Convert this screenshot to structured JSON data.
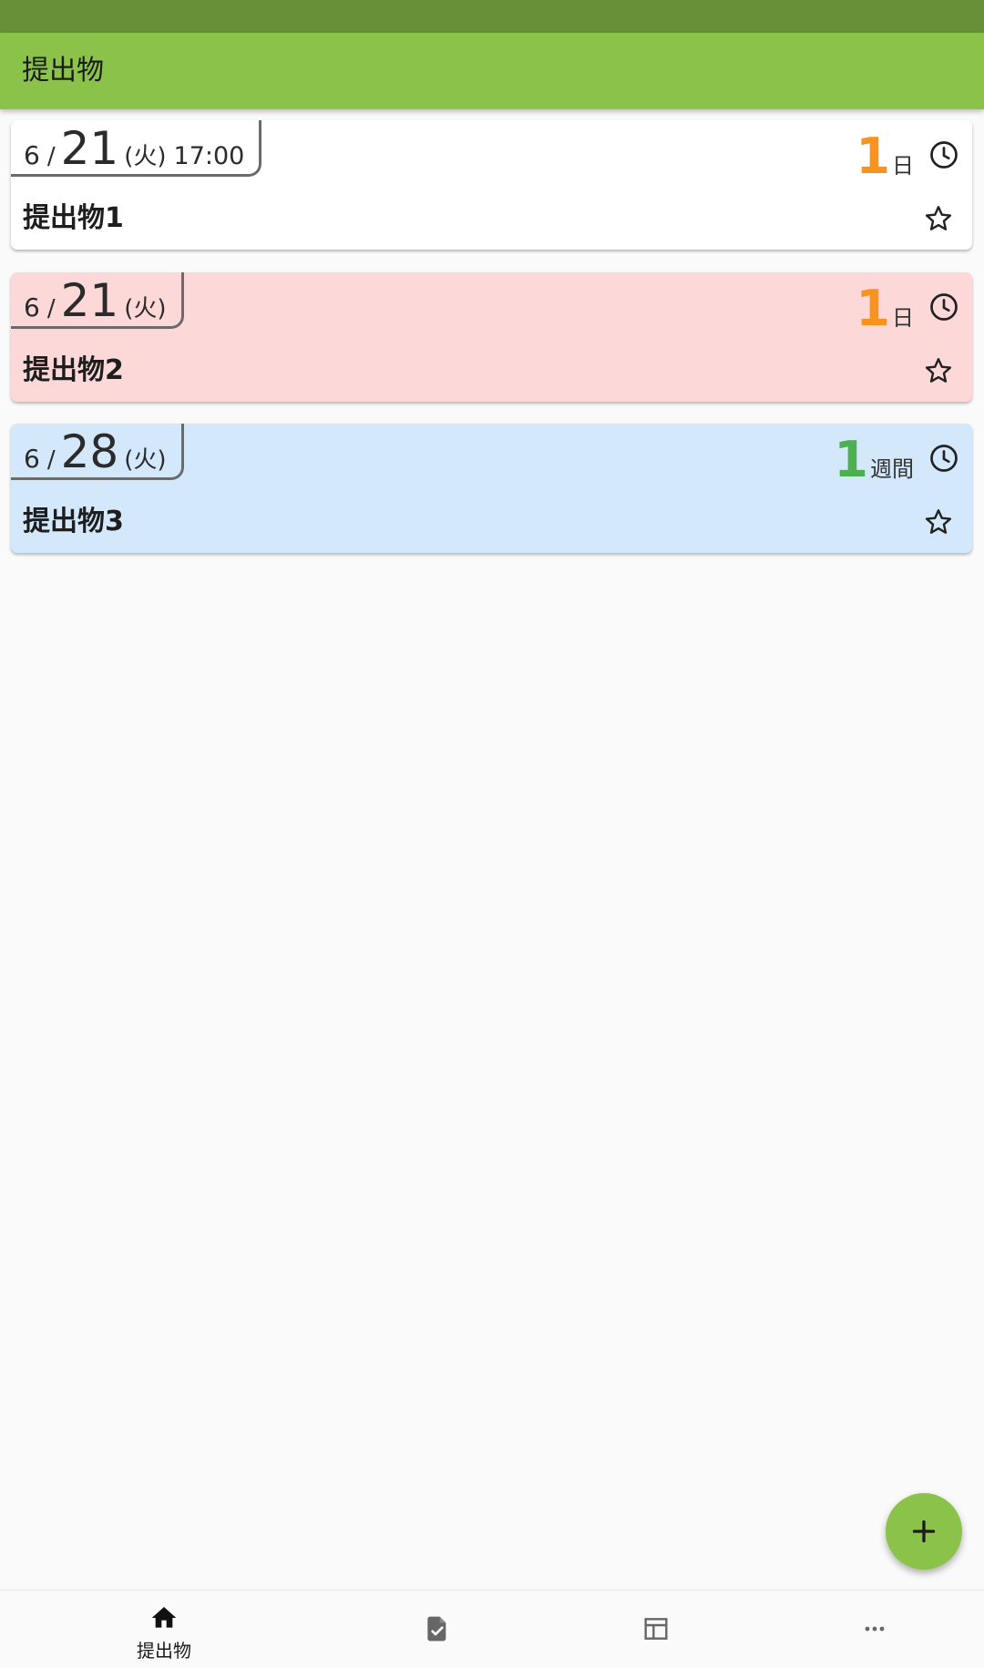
{
  "app": {
    "title": "提出物",
    "accent_color": "#8bc34a",
    "status_bar_color": "#689038"
  },
  "cards": [
    {
      "month": "6",
      "slash": "/",
      "day": "21",
      "weekday": "(火)",
      "time": "17:00",
      "remaining_value": "1",
      "remaining_unit": "日",
      "remaining_color": "#f7931e",
      "title": "提出物1",
      "background": "#ffffff",
      "clock_icon": "clock-icon",
      "star_icon": "star-outline-icon"
    },
    {
      "month": "6",
      "slash": "/",
      "day": "21",
      "weekday": "(火)",
      "time": "",
      "remaining_value": "1",
      "remaining_unit": "日",
      "remaining_color": "#f7931e",
      "title": "提出物2",
      "background": "#fdd8d8",
      "clock_icon": "clock-icon",
      "star_icon": "star-outline-icon"
    },
    {
      "month": "6",
      "slash": "/",
      "day": "28",
      "weekday": "(火)",
      "time": "",
      "remaining_value": "1",
      "remaining_unit": "週間",
      "remaining_color": "#4caf50",
      "title": "提出物3",
      "background": "#d3e8fb",
      "clock_icon": "clock-icon",
      "star_icon": "star-outline-icon"
    }
  ],
  "fab": {
    "icon": "plus-icon"
  },
  "bottom_nav": {
    "items": [
      {
        "icon": "home-icon",
        "label": "提出物"
      },
      {
        "icon": "document-check-icon",
        "label": ""
      },
      {
        "icon": "table-icon",
        "label": ""
      },
      {
        "icon": "more-horizontal-icon",
        "label": ""
      }
    ]
  }
}
